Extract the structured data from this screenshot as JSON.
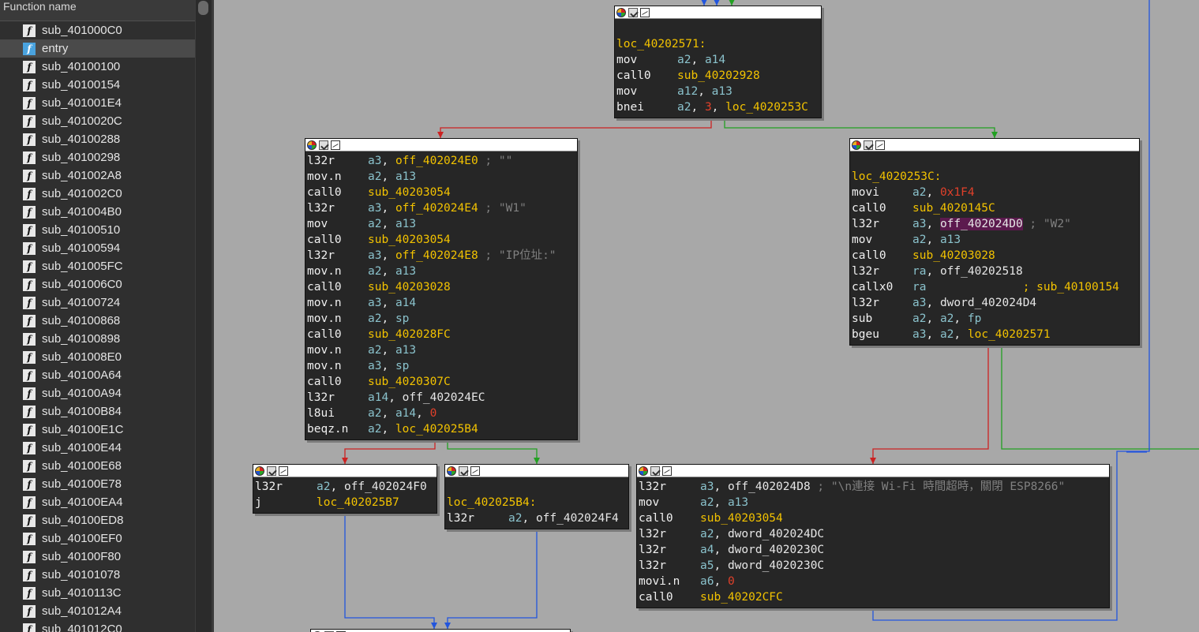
{
  "function_list": {
    "header": "Function name",
    "items": [
      {
        "name": "sub_401000C0"
      },
      {
        "name": "entry",
        "selected": true
      },
      {
        "name": "sub_40100100"
      },
      {
        "name": "sub_40100154"
      },
      {
        "name": "sub_401001E4"
      },
      {
        "name": "sub_4010020C"
      },
      {
        "name": "sub_40100288"
      },
      {
        "name": "sub_40100298"
      },
      {
        "name": "sub_401002A8"
      },
      {
        "name": "sub_401002C0"
      },
      {
        "name": "sub_401004B0"
      },
      {
        "name": "sub_40100510"
      },
      {
        "name": "sub_40100594"
      },
      {
        "name": "sub_401005FC"
      },
      {
        "name": "sub_401006C0"
      },
      {
        "name": "sub_40100724"
      },
      {
        "name": "sub_40100868"
      },
      {
        "name": "sub_40100898"
      },
      {
        "name": "sub_401008E0"
      },
      {
        "name": "sub_40100A64"
      },
      {
        "name": "sub_40100A94"
      },
      {
        "name": "sub_40100B84"
      },
      {
        "name": "sub_40100E1C"
      },
      {
        "name": "sub_40100E44"
      },
      {
        "name": "sub_40100E68"
      },
      {
        "name": "sub_40100E78"
      },
      {
        "name": "sub_40100EA4"
      },
      {
        "name": "sub_40100ED8"
      },
      {
        "name": "sub_40100EF0"
      },
      {
        "name": "sub_40100F80"
      },
      {
        "name": "sub_40101078"
      },
      {
        "name": "sub_4010113C"
      },
      {
        "name": "sub_401012A4"
      },
      {
        "name": "sub_401012C0"
      }
    ]
  },
  "colors": {
    "edge_true": "#22a022",
    "edge_false": "#cc2222",
    "edge_jump": "#2255dd",
    "node_bg": "#262626",
    "graph_bg": "#a8a8a8"
  },
  "nodes": [
    {
      "id": "loc_40202571",
      "lines": [
        {
          "blank": true
        },
        {
          "label": "loc_40202571:"
        },
        {
          "op": "mov",
          "args": [
            [
              "reg",
              "a2"
            ],
            [
              ",",
              ", "
            ],
            [
              "reg",
              "a14"
            ]
          ]
        },
        {
          "op": "call0",
          "args": [
            [
              "sym",
              "sub_40202928"
            ]
          ]
        },
        {
          "op": "mov",
          "args": [
            [
              "reg",
              "a12"
            ],
            [
              ",",
              ", "
            ],
            [
              "reg",
              "a13"
            ]
          ]
        },
        {
          "op": "bnei",
          "args": [
            [
              "reg",
              "a2"
            ],
            [
              ",",
              ", "
            ],
            [
              "num",
              "3"
            ],
            [
              ",",
              ", "
            ],
            [
              "sym",
              "loc_4020253C"
            ]
          ]
        }
      ]
    },
    {
      "id": "block_left",
      "lines": [
        {
          "op": "l32r",
          "args": [
            [
              "reg",
              "a3"
            ],
            [
              ",",
              ", "
            ],
            [
              "sym",
              "off_402024E0"
            ],
            [
              "cm",
              " ; \"\""
            ]
          ]
        },
        {
          "op": "mov.n",
          "args": [
            [
              "reg",
              "a2"
            ],
            [
              ",",
              ", "
            ],
            [
              "reg",
              "a13"
            ]
          ]
        },
        {
          "op": "call0",
          "args": [
            [
              "sym",
              "sub_40203054"
            ]
          ]
        },
        {
          "op": "l32r",
          "args": [
            [
              "reg",
              "a3"
            ],
            [
              ",",
              ", "
            ],
            [
              "sym",
              "off_402024E4"
            ],
            [
              "cm",
              " ; \"W1\""
            ]
          ]
        },
        {
          "op": "mov",
          "args": [
            [
              "reg",
              "a2"
            ],
            [
              ",",
              ", "
            ],
            [
              "reg",
              "a13"
            ]
          ]
        },
        {
          "op": "call0",
          "args": [
            [
              "sym",
              "sub_40203054"
            ]
          ]
        },
        {
          "op": "l32r",
          "args": [
            [
              "reg",
              "a3"
            ],
            [
              ",",
              ", "
            ],
            [
              "sym",
              "off_402024E8"
            ],
            [
              "cm",
              " ; \"IP位址:\""
            ]
          ]
        },
        {
          "op": "mov.n",
          "args": [
            [
              "reg",
              "a2"
            ],
            [
              ",",
              ", "
            ],
            [
              "reg",
              "a13"
            ]
          ]
        },
        {
          "op": "call0",
          "args": [
            [
              "sym",
              "sub_40203028"
            ]
          ]
        },
        {
          "op": "mov.n",
          "args": [
            [
              "reg",
              "a3"
            ],
            [
              ",",
              ", "
            ],
            [
              "reg",
              "a14"
            ]
          ]
        },
        {
          "op": "mov.n",
          "args": [
            [
              "reg",
              "a2"
            ],
            [
              ",",
              ", "
            ],
            [
              "reg",
              "sp"
            ]
          ]
        },
        {
          "op": "call0",
          "args": [
            [
              "sym",
              "sub_402028FC"
            ]
          ]
        },
        {
          "op": "mov.n",
          "args": [
            [
              "reg",
              "a2"
            ],
            [
              ",",
              ", "
            ],
            [
              "reg",
              "a13"
            ]
          ]
        },
        {
          "op": "mov.n",
          "args": [
            [
              "reg",
              "a3"
            ],
            [
              ",",
              ", "
            ],
            [
              "reg",
              "sp"
            ]
          ]
        },
        {
          "op": "call0",
          "args": [
            [
              "sym",
              "sub_4020307C"
            ]
          ]
        },
        {
          "op": "l32r",
          "args": [
            [
              "reg",
              "a14"
            ],
            [
              ",",
              ", "
            ],
            [
              "txt",
              "off_402024EC"
            ]
          ]
        },
        {
          "op": "l8ui",
          "args": [
            [
              "reg",
              "a2"
            ],
            [
              ",",
              ", "
            ],
            [
              "reg",
              "a14"
            ],
            [
              ",",
              ", "
            ],
            [
              "num",
              "0"
            ]
          ]
        },
        {
          "op": "beqz.n",
          "args": [
            [
              "reg",
              "a2"
            ],
            [
              ",",
              ", "
            ],
            [
              "sym",
              "loc_402025B4"
            ]
          ]
        }
      ]
    },
    {
      "id": "loc_4020253C",
      "lines": [
        {
          "blank": true
        },
        {
          "label": "loc_4020253C:"
        },
        {
          "op": "movi",
          "args": [
            [
              "reg",
              "a2"
            ],
            [
              ",",
              ", "
            ],
            [
              "num",
              "0x1F4"
            ]
          ]
        },
        {
          "op": "call0",
          "args": [
            [
              "sym",
              "sub_4020145C"
            ]
          ]
        },
        {
          "op": "l32r",
          "args": [
            [
              "reg",
              "a3"
            ],
            [
              ",",
              ", "
            ],
            [
              "hl",
              "off_402024D0"
            ],
            [
              "cm",
              " ; \"W2\""
            ]
          ]
        },
        {
          "op": "mov",
          "args": [
            [
              "reg",
              "a2"
            ],
            [
              ",",
              ", "
            ],
            [
              "reg",
              "a13"
            ]
          ]
        },
        {
          "op": "call0",
          "args": [
            [
              "sym",
              "sub_40203028"
            ]
          ]
        },
        {
          "op": "l32r",
          "args": [
            [
              "reg",
              "ra"
            ],
            [
              ",",
              ", "
            ],
            [
              "txt",
              "off_40202518"
            ]
          ]
        },
        {
          "op": "callx0",
          "args": [
            [
              "reg",
              "ra"
            ],
            [
              "txt",
              "              "
            ],
            [
              "sym",
              "; sub_40100154"
            ]
          ]
        },
        {
          "op": "l32r",
          "args": [
            [
              "reg",
              "a3"
            ],
            [
              ",",
              ", "
            ],
            [
              "txt",
              "dword_402024D4"
            ]
          ]
        },
        {
          "op": "sub",
          "args": [
            [
              "reg",
              "a2"
            ],
            [
              ",",
              ", "
            ],
            [
              "reg",
              "a2"
            ],
            [
              ",",
              ", "
            ],
            [
              "reg",
              "fp"
            ]
          ]
        },
        {
          "op": "bgeu",
          "args": [
            [
              "reg",
              "a3"
            ],
            [
              ",",
              ", "
            ],
            [
              "reg",
              "a2"
            ],
            [
              ",",
              ", "
            ],
            [
              "sym",
              "loc_40202571"
            ]
          ]
        }
      ]
    },
    {
      "id": "block_j",
      "lines": [
        {
          "op": "l32r",
          "args": [
            [
              "reg",
              "a2"
            ],
            [
              ",",
              ", "
            ],
            [
              "txt",
              "off_402024F0"
            ]
          ]
        },
        {
          "op": "j",
          "args": [
            [
              "sym",
              "loc_402025B7"
            ]
          ]
        }
      ]
    },
    {
      "id": "loc_402025B4",
      "lines": [
        {
          "blank": true
        },
        {
          "label": "loc_402025B4:"
        },
        {
          "op": "l32r",
          "args": [
            [
              "reg",
              "a2"
            ],
            [
              ",",
              ", "
            ],
            [
              "txt",
              "off_402024F4"
            ]
          ]
        }
      ]
    },
    {
      "id": "block_timeout",
      "lines": [
        {
          "op": "l32r",
          "args": [
            [
              "reg",
              "a3"
            ],
            [
              ",",
              ", "
            ],
            [
              "txt",
              "off_402024D8"
            ],
            [
              "cm",
              " ; \"\\n連接 Wi-Fi 時間超時，關閉 ESP8266\""
            ]
          ]
        },
        {
          "op": "mov",
          "args": [
            [
              "reg",
              "a2"
            ],
            [
              ",",
              ", "
            ],
            [
              "reg",
              "a13"
            ]
          ]
        },
        {
          "op": "call0",
          "args": [
            [
              "sym",
              "sub_40203054"
            ]
          ]
        },
        {
          "op": "l32r",
          "args": [
            [
              "reg",
              "a2"
            ],
            [
              ",",
              ", "
            ],
            [
              "txt",
              "dword_402024DC"
            ]
          ]
        },
        {
          "op": "l32r",
          "args": [
            [
              "reg",
              "a4"
            ],
            [
              ",",
              ", "
            ],
            [
              "txt",
              "dword_4020230C"
            ]
          ]
        },
        {
          "op": "l32r",
          "args": [
            [
              "reg",
              "a5"
            ],
            [
              ",",
              ", "
            ],
            [
              "txt",
              "dword_4020230C"
            ]
          ]
        },
        {
          "op": "movi.n",
          "args": [
            [
              "reg",
              "a6"
            ],
            [
              ",",
              ", "
            ],
            [
              "num",
              "0"
            ]
          ]
        },
        {
          "op": "call0",
          "args": [
            [
              "sym",
              "sub_40202CFC"
            ]
          ]
        }
      ]
    },
    {
      "id": "block_bottom",
      "lines": []
    }
  ]
}
